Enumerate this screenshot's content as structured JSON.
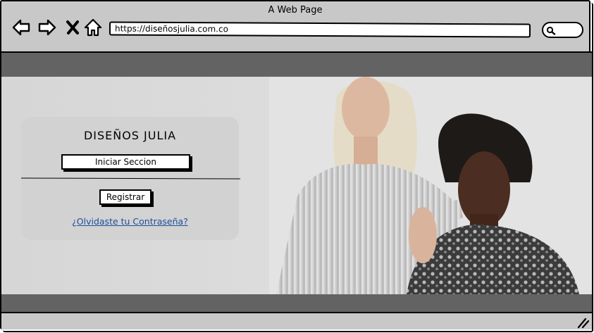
{
  "window": {
    "title": "A Web Page"
  },
  "browser": {
    "url": "https://diseñosjulia.com.co",
    "nav_icons": [
      "back-arrow-icon",
      "forward-arrow-icon",
      "close-icon",
      "home-icon"
    ],
    "search_icon": "search-icon"
  },
  "login": {
    "brand": "DISEÑOS JULIA",
    "login_button": "Iniciar Seccion",
    "register_button": "Registrar",
    "forgot_link": "¿Olvidaste tu Contraseña?"
  },
  "hero": {
    "image": "two-models-photo"
  },
  "colors": {
    "frame": "#c8c8c8",
    "band": "#636363",
    "link": "#1e4f9e"
  }
}
